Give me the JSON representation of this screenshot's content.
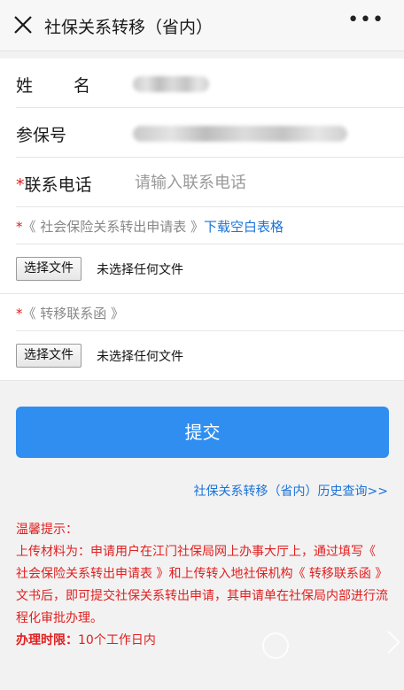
{
  "header": {
    "title": "社保关系转移（省内）",
    "more_icon": "more-icon",
    "close_icon": "close-icon"
  },
  "form": {
    "name_label": "姓  名",
    "insurance_no_label": "参保号",
    "phone_required_mark": "*",
    "phone_label": "联系电话",
    "phone_placeholder": "请输入联系电话",
    "phone_value": ""
  },
  "uploads": [
    {
      "required_mark": "*",
      "title": "《 社会保险关系转出申请表 》",
      "link": "下载空白表格",
      "button": "选择文件",
      "status": "未选择任何文件"
    },
    {
      "required_mark": "*",
      "title": "《 转移联系函 》",
      "link": "",
      "button": "选择文件",
      "status": "未选择任何文件"
    }
  ],
  "submit_label": "提交",
  "history_link": "社保关系转移（省内）历史查询>>",
  "tips": {
    "heading": "温馨提示：",
    "body": "上传材料为：申请用户在江门社保局网上办事大厅上，通过填写《 社会保险关系转出申请表 》和上传转入地社保机构《 转移联系函 》文书后，即可提交社保关系转出申请，其申请单在社保局内部进行流程化审批办理。",
    "limit_label": "办理时限：",
    "limit_value": "10个工作日内"
  },
  "colors": {
    "accent": "#2f8ef0",
    "link": "#1a73d8",
    "warning": "#e02020"
  }
}
